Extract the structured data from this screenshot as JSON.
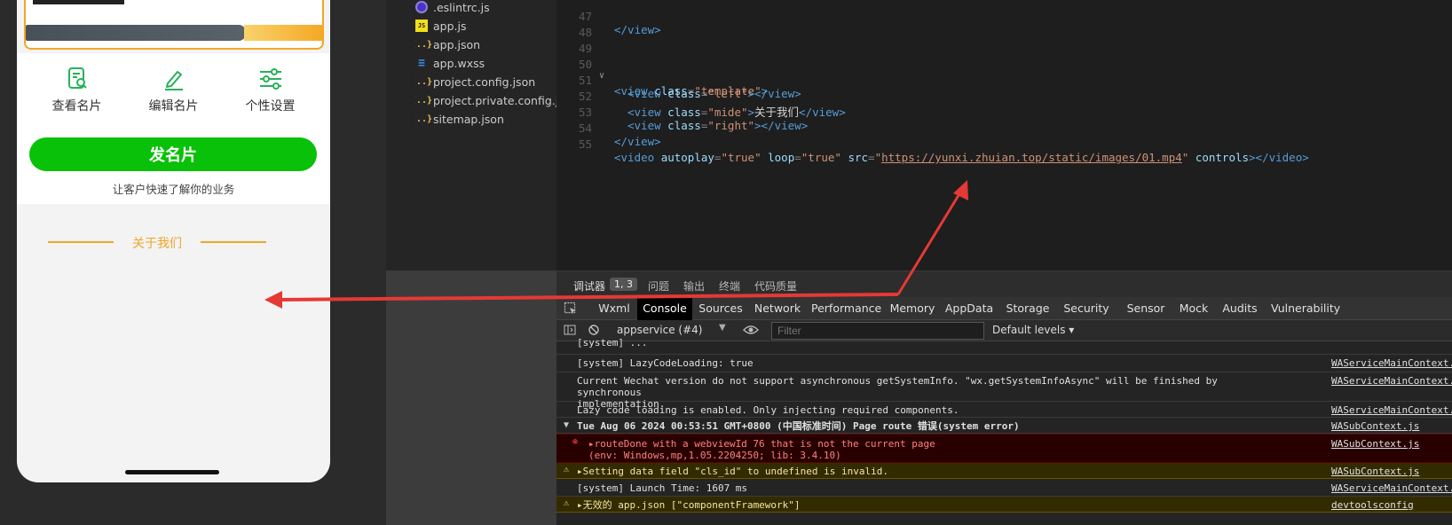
{
  "simulator": {
    "icons": [
      {
        "label": "查看名片",
        "icon": "card-search-icon"
      },
      {
        "label": "编辑名片",
        "icon": "pen-icon"
      },
      {
        "label": "个性设置",
        "icon": "sliders-icon"
      }
    ],
    "send_button": "发名片",
    "sub_text": "让客户快速了解你的业务",
    "about_title": "关于我们"
  },
  "filetree": {
    "files": [
      {
        "name": ".eslintrc.js",
        "type": "eslint"
      },
      {
        "name": "app.js",
        "type": "js"
      },
      {
        "name": "app.json",
        "type": "json"
      },
      {
        "name": "app.wxss",
        "type": "wxss"
      },
      {
        "name": "project.config.json",
        "type": "json"
      },
      {
        "name": "project.private.config.js...",
        "type": "json"
      },
      {
        "name": "sitemap.json",
        "type": "json"
      }
    ]
  },
  "editor": {
    "line_numbers": [
      "47",
      "48",
      "49",
      "50",
      "51",
      "52",
      "53",
      "54",
      "55"
    ],
    "code": {
      "l47_close": "</view>",
      "l50_open": "<view",
      "l50_attr": "class",
      "l50_val": "\"template\"",
      "l51_attr": "class",
      "l51_val": "\"left\"",
      "l52_attr": "class",
      "l52_val": "\"mide\"",
      "l52_text": "关于我们",
      "l53_attr": "class",
      "l53_val": "\"right\"",
      "l54_close": "</view>",
      "l55_autoplay": "autoplay",
      "l55_autoplay_val": "\"true\"",
      "l55_loop": "loop",
      "l55_loop_val": "\"true\"",
      "l55_src": "src",
      "l55_url": "https://yunxi.zhuian.top/static/images/01.mp4",
      "l55_controls": "controls"
    }
  },
  "devtools": {
    "panel_tabs": [
      "调试器",
      "问题",
      "输出",
      "终端",
      "代码质量"
    ],
    "panel_badge": "1, 3",
    "tabs": [
      "Wxml",
      "Console",
      "Sources",
      "Network",
      "Performance",
      "Memory",
      "AppData",
      "Storage",
      "Security",
      "Sensor",
      "Mock",
      "Audits",
      "Vulnerability"
    ],
    "active_tab": "Console",
    "context": "appservice (#4)",
    "filter_placeholder": "Filter",
    "levels": "Default levels ▾",
    "messages": [
      {
        "text": "[system] LazyCodeLoading: true",
        "source": "WAServiceMainContext.js",
        "kind": "log"
      },
      {
        "text": "Current Wechat version do not support asynchronous getSystemInfo. \"wx.getSystemInfoAsync\" will be finished by synchronous\nimplementation.",
        "source": "WAServiceMainContext.js",
        "kind": "log"
      },
      {
        "text": "Lazy code loading is enabled. Only injecting required components.",
        "source": "WAServiceMainContext.js",
        "kind": "log"
      },
      {
        "text": "Tue Aug 06 2024 00:53:51 GMT+0800 (中国标准时间) Page route 错误(system error)",
        "source": "WASubContext.js",
        "kind": "group"
      },
      {
        "text": "▸routeDone with a webviewId 76 that is not the current page\n(env: Windows,mp,1.05.2204250; lib: 3.4.10)",
        "source": "WASubContext.js",
        "kind": "error"
      },
      {
        "text": "▸Setting data field \"cls_id\" to undefined is invalid.",
        "source": "WASubContext.js",
        "kind": "warn"
      },
      {
        "text": "[system] Launch Time: 1607 ms",
        "source": "WAServiceMainContext.js",
        "kind": "log"
      },
      {
        "text": "▸无效的 app.json [\"componentFramework\"]",
        "source": "devtoolsconfig",
        "kind": "warn"
      }
    ]
  },
  "colors": {
    "accent_gold": "#f0a726",
    "send_green": "#09c108",
    "annotation_red": "#e53935"
  }
}
